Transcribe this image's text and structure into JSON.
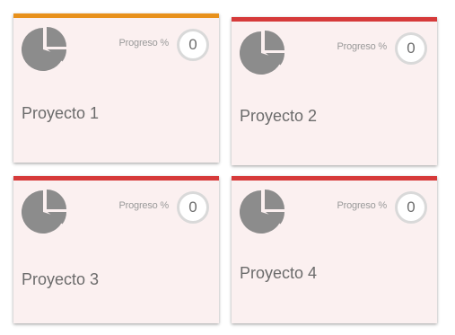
{
  "colors": {
    "card_background": "#fbf0f0",
    "accent_orange": "#e8911c",
    "accent_red": "#d63a3a",
    "pie_gray": "#8c8c8c",
    "text_gray": "#6b6b6b"
  },
  "cards": [
    {
      "title": "Proyecto 1",
      "progress_label": "Progreso %",
      "progress_value": "0",
      "accent": "#e8911c",
      "icon": "pie-chart-icon"
    },
    {
      "title": "Proyecto 2",
      "progress_label": "Progreso %",
      "progress_value": "0",
      "accent": "#d63a3a",
      "icon": "pie-chart-icon"
    },
    {
      "title": "Proyecto 3",
      "progress_label": "Progreso %",
      "progress_value": "0",
      "accent": "#d63a3a",
      "icon": "pie-chart-icon"
    },
    {
      "title": "Proyecto 4",
      "progress_label": "Progreso %",
      "progress_value": "0",
      "accent": "#d63a3a",
      "icon": "pie-chart-icon"
    }
  ]
}
